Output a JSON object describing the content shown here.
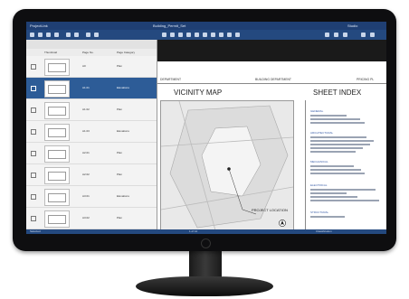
{
  "app": {
    "title_left": "ProjectLink",
    "title_center": "Building_Permit_Set",
    "title_right": "Studio"
  },
  "panel": {
    "headers": [
      "Thumbnail",
      "Page No.",
      "Page Category"
    ],
    "rows": [
      {
        "num": "A0",
        "category": "Plan",
        "selected": false
      },
      {
        "num": "A1.01",
        "category": "Elevations",
        "selected": true
      },
      {
        "num": "A1.02",
        "category": "Plan",
        "selected": false
      },
      {
        "num": "A1.03",
        "category": "Elevations",
        "selected": false
      },
      {
        "num": "A2.01",
        "category": "Plan",
        "selected": false
      },
      {
        "num": "A2.02",
        "category": "Plan",
        "selected": false
      },
      {
        "num": "A3.01",
        "category": "Elevations",
        "selected": false
      },
      {
        "num": "A3.02",
        "category": "Plan",
        "selected": false
      }
    ]
  },
  "doc": {
    "bar_left": "DEPARTMENT",
    "bar_center": "BUILDING DEPARTMENT",
    "bar_right": "PRICING PL",
    "vicinity_title": "VICINITY MAP",
    "sheet_index_title": "SHEET INDEX",
    "project_location": "PROJECT LOCATION",
    "sections": [
      "GENERAL",
      "ARCHITECTURAL",
      "MECHANICAL",
      "ELECTRICAL",
      "STRUCTURAL"
    ]
  },
  "status": {
    "left": "Selected",
    "center": "1 of 12",
    "right": "Classification"
  },
  "colors": {
    "app_blue": "#24497f",
    "selection": "#2d5c97"
  }
}
